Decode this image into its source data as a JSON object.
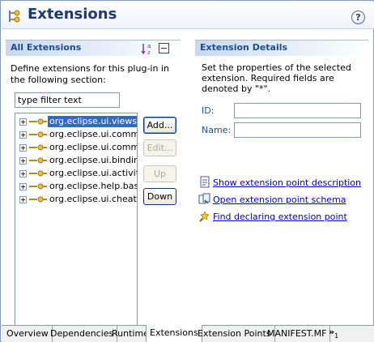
{
  "header": {
    "title": "Extensions",
    "help": "?"
  },
  "all_extensions": {
    "title": "All Extensions",
    "description": "Define extensions for this plug-in in the following section:",
    "filter_value": "type filter text",
    "items": [
      {
        "label": "org.eclipse.ui.views",
        "selected": true
      },
      {
        "label": "org.eclipse.ui.comma"
      },
      {
        "label": "org.eclipse.ui.comma"
      },
      {
        "label": "org.eclipse.ui.binding"
      },
      {
        "label": "org.eclipse.ui.activity"
      },
      {
        "label": "org.eclipse.help.base"
      },
      {
        "label": "org.eclipse.ui.cheats"
      }
    ],
    "buttons": {
      "add": "Add...",
      "edit": "Edit...",
      "up": "Up",
      "down": "Down"
    }
  },
  "extension_details": {
    "title": "Extension Details",
    "description": "Set the properties of the selected extension. Required fields are denoted by \"*\".",
    "id_label": "ID:",
    "name_label": "Name:",
    "id_value": "",
    "name_value": ""
  },
  "links": {
    "show_description": "Show extension point description",
    "open_schema": "Open extension point schema",
    "find_declaring": "Find declaring extension point"
  },
  "tabs": [
    {
      "label": "Overview"
    },
    {
      "label": "Dependencies"
    },
    {
      "label": "Runtime"
    },
    {
      "label": "Extensions",
      "active": true
    },
    {
      "label": "Extension Points"
    },
    {
      "label": "MANIFEST.MF"
    }
  ],
  "tabs_more": {
    "glyph": "»",
    "count": "1"
  },
  "colors": {
    "title": "#1e3a72",
    "section_title": "#1c4d8c",
    "selection": "#316ac5",
    "link": "#0000cc"
  }
}
